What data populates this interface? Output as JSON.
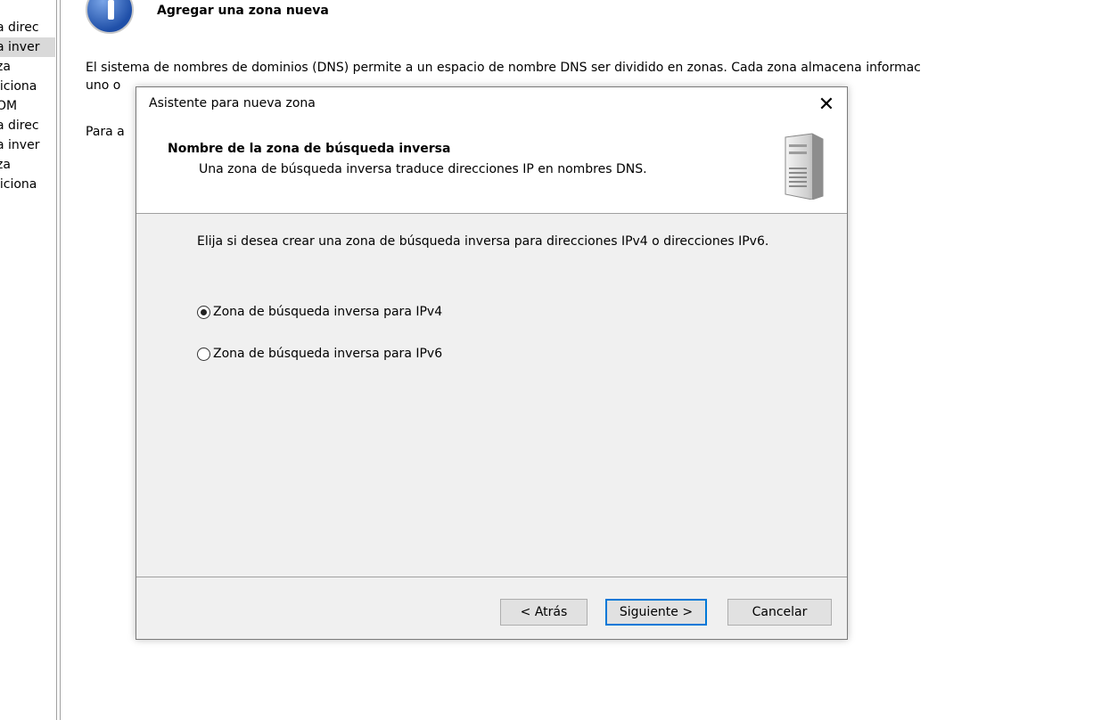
{
  "left_tree": {
    "items": [
      "a direc",
      "a inver",
      "za",
      "licionа",
      "OM",
      "a direc",
      "a inver",
      "za",
      "licionа"
    ],
    "selected_index": 1
  },
  "background_page": {
    "title": "Agregar una zona nueva",
    "para1": "El sistema de nombres de dominios (DNS) permite a un espacio de nombre DNS ser dividido en zonas. Cada zona almacena informac",
    "para1_cont": "uno o",
    "para2": "Para a"
  },
  "dialog": {
    "title": "Asistente para nueva zona",
    "close_symbol": "✕",
    "header_title": "Nombre de la zona de búsqueda inversa",
    "header_subtitle": "Una zona de búsqueda inversa traduce direcciones IP en nombres DNS.",
    "prompt": "Elija si desea crear una zona de búsqueda inversa para direcciones IPv4 o direcciones IPv6.",
    "options": [
      {
        "label": "Zona de búsqueda inversa para IPv4",
        "checked": true
      },
      {
        "label": "Zona de búsqueda inversa para IPv6",
        "checked": false
      }
    ],
    "buttons": {
      "back": "< Atrás",
      "next": "Siguiente >",
      "cancel": "Cancelar"
    },
    "accent_color": "#0078d7"
  }
}
